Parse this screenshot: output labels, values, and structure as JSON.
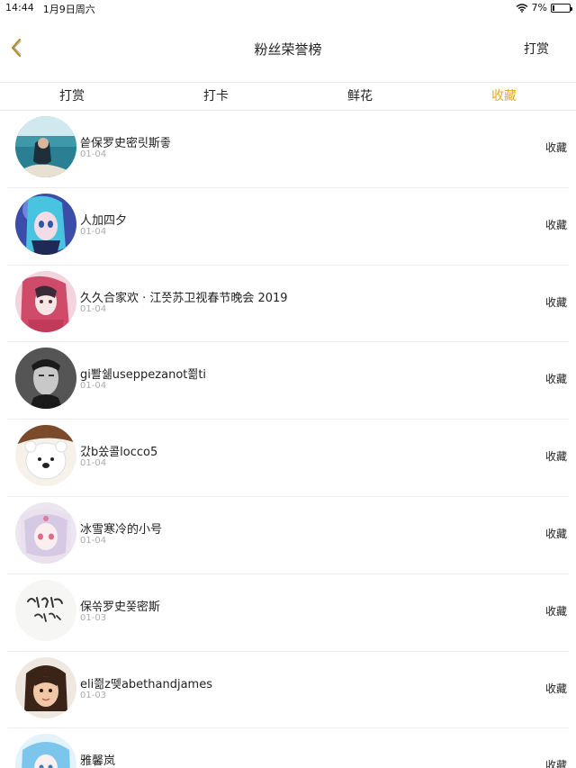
{
  "status": {
    "time": "14:44",
    "date": "1月9日周六",
    "battery": "7%"
  },
  "nav": {
    "title": "粉丝荣誉榜",
    "right_label": "打赏"
  },
  "tabs": [
    {
      "label": "打赏",
      "active": false
    },
    {
      "label": "打卡",
      "active": false
    },
    {
      "label": "鲜花",
      "active": false
    },
    {
      "label": "收藏",
      "active": true
    }
  ],
  "colors": {
    "accent": "#e6a821",
    "divider": "#ececec",
    "date": "#aaaaaa"
  },
  "items": [
    {
      "name": "씉保罗史密릿斯좋",
      "date": "01-04",
      "action": "收藏",
      "avatar": "sea-girl"
    },
    {
      "name": "人加四夕",
      "date": "01-04",
      "action": "收藏",
      "avatar": "blue-anime"
    },
    {
      "name": "久久合家欢 · 江쯧苏卫视春节晚会 2019",
      "date": "01-04",
      "action": "收藏",
      "avatar": "pink-anime"
    },
    {
      "name": "gi뽤쉚useppezanot쬚ti",
      "date": "01-04",
      "action": "收藏",
      "avatar": "man-bw"
    },
    {
      "name": "갔b쏬콜locco5",
      "date": "01-04",
      "action": "收藏",
      "avatar": "white-bear"
    },
    {
      "name": "冰雪寒冷的小号",
      "date": "01-04",
      "action": "收藏",
      "avatar": "anime-girl"
    },
    {
      "name": "保쏚罗史쫒密斯",
      "date": "01-03",
      "action": "收藏",
      "avatar": "calligraphy"
    },
    {
      "name": "eli쯺z뗒abethandjames",
      "date": "01-03",
      "action": "收藏",
      "avatar": "child"
    },
    {
      "name": "雅馨岚",
      "date": "",
      "action": "收藏",
      "avatar": "blue-anime-2"
    }
  ]
}
